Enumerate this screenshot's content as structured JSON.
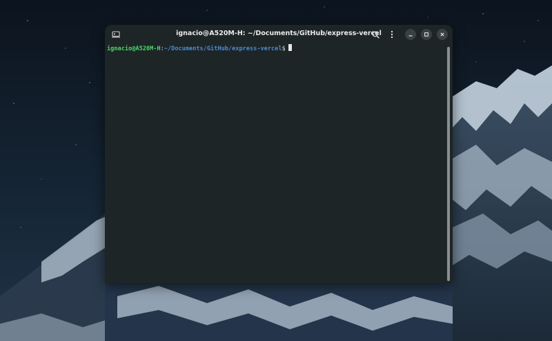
{
  "terminal": {
    "title": "ignacio@A520M-H: ~/Documents/GitHub/express-vercel",
    "prompt": {
      "user_host": "ignacio@A520M-H",
      "separator": ":",
      "path": "~/Documents/GitHub/express-vercel",
      "symbol": "$"
    },
    "header_icons": {
      "new_tab": "terminal-new-tab-icon",
      "search": "search-icon",
      "menu": "kebab-menu-icon",
      "minimize": "minimize-icon",
      "maximize": "maximize-icon",
      "close": "close-icon"
    }
  },
  "colors": {
    "terminal_bg": "#1e2526",
    "prompt_user": "#4bd66b",
    "prompt_path": "#4a8bd4",
    "text": "#eaeaea",
    "window_button_bg": "#3a4142"
  }
}
